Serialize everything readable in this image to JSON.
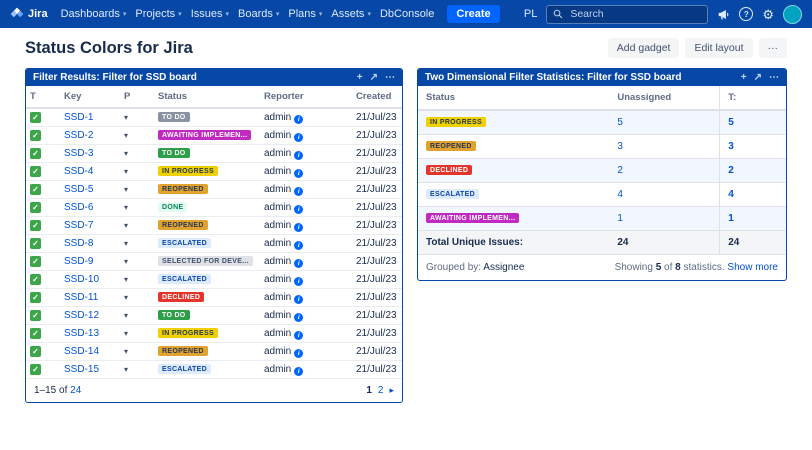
{
  "icons": {
    "caret": "▾",
    "move": "+",
    "expand": "↗",
    "menu": "⋯",
    "gear": "⚙",
    "help": "?",
    "check": "✓",
    "info": "i",
    "priority": "▾",
    "next": "▸"
  },
  "navbar": {
    "brand": "Jira",
    "items": [
      {
        "label": "Dashboards",
        "caret": true
      },
      {
        "label": "Projects",
        "caret": true
      },
      {
        "label": "Issues",
        "caret": true
      },
      {
        "label": "Boards",
        "caret": true
      },
      {
        "label": "Plans",
        "caret": true
      },
      {
        "label": "Assets",
        "caret": true
      },
      {
        "label": "DbConsole",
        "caret": false
      }
    ],
    "create_label": "Create",
    "locale": "PL",
    "search_placeholder": "Search"
  },
  "page": {
    "title": "Status Colors for Jira",
    "actions": [
      {
        "label": "Add gadget"
      },
      {
        "label": "Edit layout"
      },
      {
        "label": "···"
      }
    ]
  },
  "filter_results": {
    "title": "Filter Results: Filter for SSD board",
    "columns": [
      "T",
      "Key",
      "P",
      "Status",
      "Reporter",
      "Created"
    ],
    "rows": [
      {
        "key": "SSD-1",
        "status": "TO DO",
        "color": "slate",
        "reporter": "admin",
        "created": "21/Jul/23"
      },
      {
        "key": "SSD-2",
        "status": "AWAITING IMPLEMEN...",
        "color": "magenta",
        "reporter": "admin",
        "created": "21/Jul/23"
      },
      {
        "key": "SSD-3",
        "status": "TO DO",
        "color": "green",
        "reporter": "admin",
        "created": "21/Jul/23"
      },
      {
        "key": "SSD-4",
        "status": "IN PROGRESS",
        "color": "yellow",
        "reporter": "admin",
        "created": "21/Jul/23"
      },
      {
        "key": "SSD-5",
        "status": "REOPENED",
        "color": "amber",
        "reporter": "admin",
        "created": "21/Jul/23"
      },
      {
        "key": "SSD-6",
        "status": "DONE",
        "color": "done",
        "reporter": "admin",
        "created": "21/Jul/23"
      },
      {
        "key": "SSD-7",
        "status": "REOPENED",
        "color": "amber",
        "reporter": "admin",
        "created": "21/Jul/23"
      },
      {
        "key": "SSD-8",
        "status": "ESCALATED",
        "color": "lightblue",
        "reporter": "admin",
        "created": "21/Jul/23"
      },
      {
        "key": "SSD-9",
        "status": "SELECTED FOR DEVE...",
        "color": "lightgray",
        "reporter": "admin",
        "created": "21/Jul/23"
      },
      {
        "key": "SSD-10",
        "status": "ESCALATED",
        "color": "lightblue",
        "reporter": "admin",
        "created": "21/Jul/23"
      },
      {
        "key": "SSD-11",
        "status": "DECLINED",
        "color": "red",
        "reporter": "admin",
        "created": "21/Jul/23"
      },
      {
        "key": "SSD-12",
        "status": "TO DO",
        "color": "green",
        "reporter": "admin",
        "created": "21/Jul/23"
      },
      {
        "key": "SSD-13",
        "status": "IN PROGRESS",
        "color": "yellow",
        "reporter": "admin",
        "created": "21/Jul/23"
      },
      {
        "key": "SSD-14",
        "status": "REOPENED",
        "color": "amber",
        "reporter": "admin",
        "created": "21/Jul/23"
      },
      {
        "key": "SSD-15",
        "status": "ESCALATED",
        "color": "lightblue",
        "reporter": "admin",
        "created": "21/Jul/23"
      }
    ],
    "footer": {
      "range": "1–15",
      "of": "of",
      "total_link": "24",
      "pages": [
        {
          "label": "1",
          "current": true
        },
        {
          "label": "2",
          "current": false
        }
      ]
    }
  },
  "stats": {
    "title": "Two Dimensional Filter Statistics: Filter for SSD board",
    "columns": [
      "Status",
      "Unassigned",
      "T:"
    ],
    "rows": [
      {
        "status": "IN PROGRESS",
        "color": "yellow",
        "unassigned": "5",
        "total": "5"
      },
      {
        "status": "REOPENED",
        "color": "amber",
        "unassigned": "3",
        "total": "3"
      },
      {
        "status": "DECLINED",
        "color": "red",
        "unassigned": "2",
        "total": "2"
      },
      {
        "status": "ESCALATED",
        "color": "lightblue",
        "unassigned": "4",
        "total": "4"
      },
      {
        "status": "AWAITING IMPLEMEN...",
        "color": "magenta",
        "unassigned": "1",
        "total": "1"
      }
    ],
    "total_row": {
      "label": "Total Unique Issues:",
      "unassigned": "24",
      "total": "24"
    },
    "footer": {
      "grouped_by_label": "Grouped by:",
      "grouped_by_value": "Assignee",
      "showing_prefix": "Showing",
      "showing_count": "5",
      "showing_of": "of",
      "showing_total": "8",
      "showing_suffix": "statistics.",
      "show_more": "Show more"
    }
  },
  "badge_palette": {
    "slate": {
      "bg": "#8993A4",
      "fg": "#FFFFFF"
    },
    "magenta": {
      "bg": "#C02AC0",
      "fg": "#FFFFFF"
    },
    "green": {
      "bg": "#2E9E49",
      "fg": "#FFFFFF"
    },
    "yellow": {
      "bg": "#EFD000",
      "fg": "#253858"
    },
    "amber": {
      "bg": "#E2A32E",
      "fg": "#253858"
    },
    "done": {
      "bg": "#E3FCEF",
      "fg": "#00875A"
    },
    "lightblue": {
      "bg": "#DEEBFF",
      "fg": "#0747A6"
    },
    "lightgray": {
      "bg": "#DFE1E6",
      "fg": "#42526E"
    },
    "red": {
      "bg": "#E5342B",
      "fg": "#FFFFFF"
    }
  },
  "colors": {
    "navbar": "#0747A6",
    "create_button": "#0065FF",
    "gadget_header": "#0747A6",
    "link": "#0052CC"
  }
}
